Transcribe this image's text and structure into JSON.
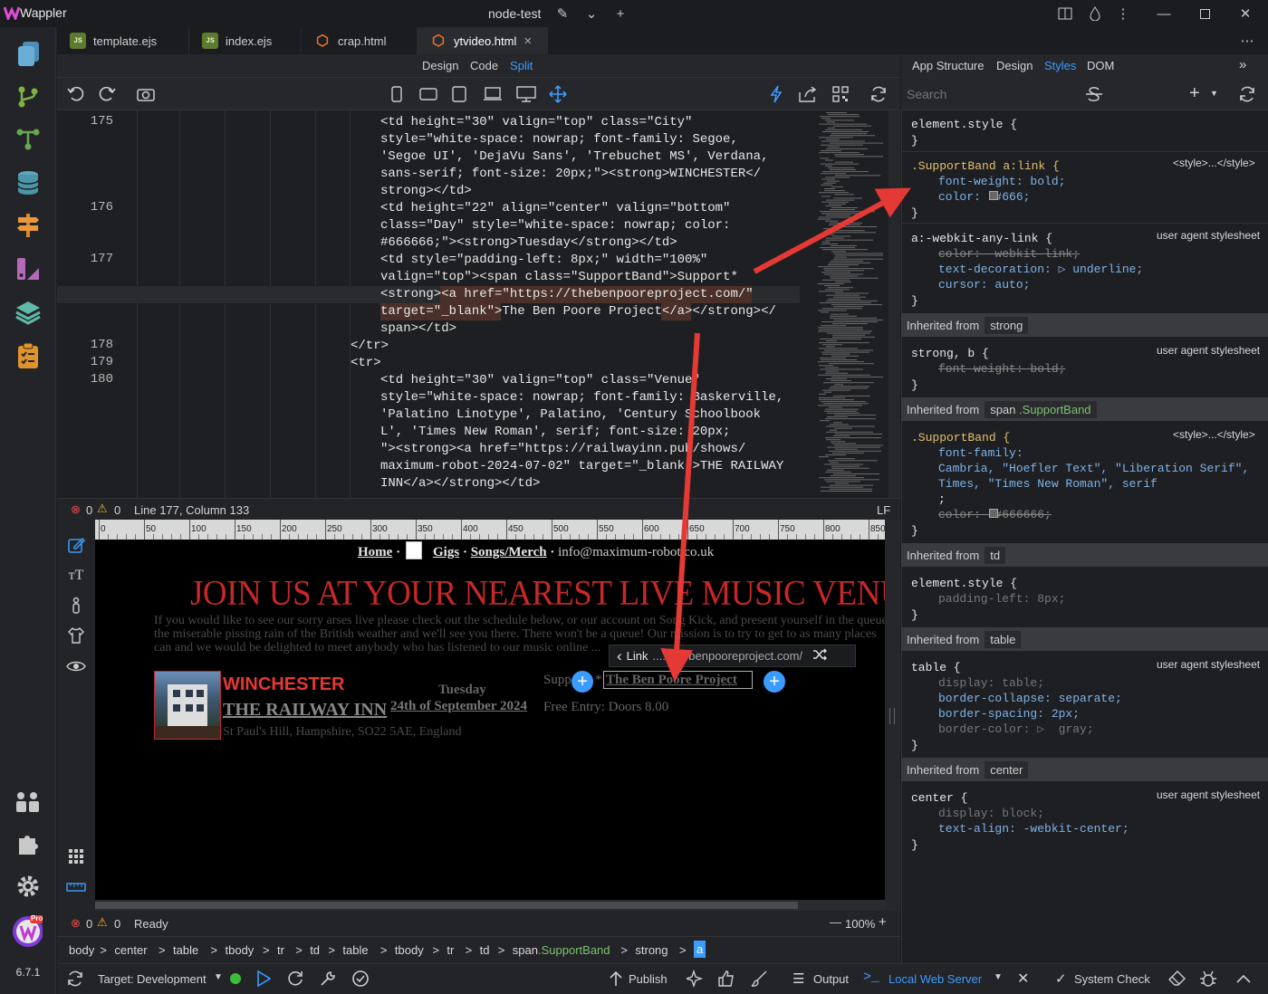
{
  "app": {
    "name": "Wappler",
    "project": "node-test",
    "version": "6.7.1"
  },
  "tabs": [
    {
      "label": "template.ejs",
      "icon": "js-file-icon"
    },
    {
      "label": "index.ejs",
      "icon": "js-file-icon"
    },
    {
      "label": "crap.html",
      "icon": "html5-file-icon"
    },
    {
      "label": "ytvideo.html",
      "icon": "html5-file-icon",
      "close": "×"
    }
  ],
  "viewtabs": {
    "design": "Design",
    "code": "Code",
    "split": "Split"
  },
  "code": {
    "lines": [
      {
        "num": "175",
        "text": "<td height=\"30\" valign=\"top\" class=\"City\""
      },
      {
        "num": "",
        "text": "style=\"white-space: nowrap; font-family: Segoe,"
      },
      {
        "num": "",
        "text": "'Segoe UI', 'DejaVu Sans', 'Trebuchet MS', Verdana,"
      },
      {
        "num": "",
        "text": "sans-serif; font-size: 20px;\"><strong>WINCHESTER</"
      },
      {
        "num": "",
        "text": "strong></td>"
      },
      {
        "num": "176",
        "text": "<td height=\"22\" align=\"center\" valign=\"bottom\""
      },
      {
        "num": "",
        "text": "class=\"Day\" style=\"white-space: nowrap; color:"
      },
      {
        "num": "",
        "text": "#666666;\"><strong>Tuesday</strong></td>"
      },
      {
        "num": "177",
        "text": "<td style=\"padding-left: 8px;\" width=\"100%\""
      },
      {
        "num": "",
        "text": "valign=\"top\"><span class=\"SupportBand\">Support*"
      },
      {
        "num": "",
        "text": "<strong><a href=\"https://thebenpooreproject.com/\""
      },
      {
        "num": "",
        "text": "target=\"_blank\">The Ben Poore Project</a></strong></"
      },
      {
        "num": "",
        "text": "span></td>"
      },
      {
        "num": "178",
        "text": "</tr>"
      },
      {
        "num": "179",
        "text": "<tr>"
      },
      {
        "num": "180",
        "text": "<td height=\"30\" valign=\"top\" class=\"Venue\""
      },
      {
        "num": "",
        "text": "style=\"white-space: nowrap; font-family: Baskerville,"
      },
      {
        "num": "",
        "text": "'Palatino Linotype', Palatino, 'Century Schoolbook"
      },
      {
        "num": "",
        "text": "L', 'Times New Roman', serif; font-size: 20px;"
      },
      {
        "num": "",
        "text": "\"><strong><a href=\"https://railwayinn.pub/shows/"
      },
      {
        "num": "",
        "text": "maximum-robot-2024-07-02\" target=\"_blank\">THE RAILWAY"
      },
      {
        "num": "",
        "text": "INN</a></strong></td>"
      }
    ]
  },
  "status1": {
    "errors": "0",
    "warnings": "0",
    "position": "Line 177, Column 133",
    "eol": "LF"
  },
  "ruler": {
    "ticks": [
      "0",
      "50",
      "100",
      "150",
      "200",
      "250",
      "300",
      "350",
      "400",
      "450",
      "500",
      "550",
      "600",
      "650",
      "700",
      "750",
      "800",
      "850"
    ]
  },
  "canvas": {
    "nav": {
      "home": "Home",
      "gigs": "Gigs",
      "songs": "Songs/Merch",
      "email": "info@maximum-robot.co.uk",
      "sep": "·"
    },
    "headline": "JOIN US AT YOUR NEAREST LIVE MUSIC VENUE ...",
    "intro1": "If you would like to see our sorry arses live please check out the schedule below, or our account on Song Kick, and present yourself in the queue",
    "intro2": "the miserable pissing rain of the British weather and we'll see you there. There won't be a queue! Our mission is to try to get to as many places",
    "intro3": "can and we would be delighted to meet anybody who has listened to our music online ...",
    "city": "WINCHESTER",
    "day": "Tuesday",
    "date": "24th of September 2024",
    "venue": "THE RAILWAY INN",
    "address": "St Paul's Hill, Hampshire, SO22 5AE, England",
    "support_prefix": "Supp",
    "support_star": "*",
    "support_link": "The Ben Poore Project",
    "entry": "Free Entry: Doors 8.00",
    "link_popup": {
      "back": "‹",
      "label": "Link",
      "url": "...://thebenpooreproject.com/"
    }
  },
  "status2": {
    "errors": "0",
    "warnings": "0",
    "state": "Ready",
    "zoom": "100%",
    "minus": "—",
    "plus": "+"
  },
  "breadcrumb": [
    "body",
    "center",
    "table",
    "tbody",
    "tr",
    "td",
    "table",
    "tbody",
    "tr",
    "td",
    "span.SupportBand",
    "strong",
    "a"
  ],
  "bottom": {
    "target_label": "Target:",
    "target_value": "Development",
    "publish": "Publish",
    "output": "Output",
    "server": "Local Web Server",
    "system_check": "System Check"
  },
  "rightpanel": {
    "tabs": {
      "app_structure": "App Structure",
      "design": "Design",
      "styles": "Styles",
      "dom": "DOM"
    },
    "search_placeholder": "Search",
    "style_tag": "<style>...</style>",
    "user_agent": "user agent stylesheet",
    "inherited_from": "Inherited from",
    "rules": {
      "element_style": "element.style {",
      "close": "}",
      "sb_link_selector": ".SupportBand a:link {",
      "sb_link_fw": "font-weight: bold;",
      "sb_link_color": "color:  #666;",
      "webkit_selector": "a:-webkit-any-link {",
      "webkit_color": "color: -webkit-link;",
      "webkit_td": "text-decoration: ▷ underline;",
      "webkit_cursor": "cursor: auto;",
      "strong_inh": "strong",
      "strong_selector": "strong, b {",
      "strong_fw": "font-weight: bold;",
      "span_inh": "span",
      "span_class": ".SupportBand",
      "sb_selector": ".SupportBand {",
      "sb_ff": "font-family:",
      "sb_ff_val1": "Cambria, \"Hoefler Text\", \"Liberation Serif\",",
      "sb_ff_val2": "Times, \"Times New Roman\", serif",
      "sb_semicolon": ";",
      "sb_color": "color:  #666666;",
      "td_inh": "td",
      "td_pad": "padding-left: 8px;",
      "table_inh": "table",
      "table_selector": "table {",
      "table_display": "display: table;",
      "table_bc": "border-collapse: separate;",
      "table_bs": "border-spacing: 2px;",
      "table_bcol": "border-color: ▷  gray;",
      "center_inh": "center",
      "center_selector": "center {",
      "center_display": "display: block;",
      "center_ta": "text-align: -webkit-center;"
    }
  },
  "colors": {
    "accent": "#3b9cff",
    "arrow": "#e53935",
    "headline": "#c62828",
    "city": "#e53935"
  }
}
